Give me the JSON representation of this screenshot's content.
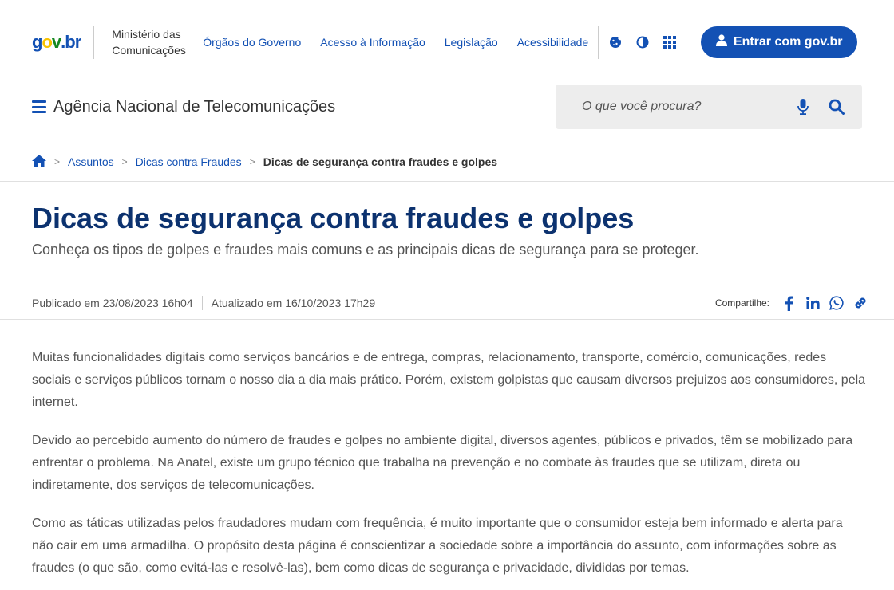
{
  "header": {
    "logo": {
      "g": "g",
      "o": "o",
      "v": "v",
      "dot": ".",
      "br": "br"
    },
    "ministry_line1": "Ministério das",
    "ministry_line2": "Comunicações",
    "links": [
      "Órgãos do Governo",
      "Acesso à Informação",
      "Legislação",
      "Acessibilidade"
    ],
    "tools": [
      "cookie-icon",
      "contrast-icon",
      "apps-grid-icon"
    ],
    "login_label": "Entrar com gov.br"
  },
  "nav": {
    "agency": "Agência Nacional de Telecomunicações",
    "search_placeholder": "O que você procura?"
  },
  "breadcrumb": {
    "items": [
      "Assuntos",
      "Dicas contra Fraudes"
    ],
    "current": "Dicas de segurança contra fraudes e golpes",
    "separator": ">"
  },
  "page": {
    "title": "Dicas de segurança contra fraudes e golpes",
    "subtitle": "Conheça os tipos de golpes e fraudes mais comuns e as principais dicas de segurança para se proteger.",
    "published": "Publicado em 23/08/2023 16h04",
    "updated": "Atualizado em 16/10/2023 17h29",
    "share_label": "Compartilhe:",
    "share_icons": [
      "facebook-icon",
      "linkedin-icon",
      "whatsapp-icon",
      "copy-link-icon"
    ],
    "paragraphs": [
      "Muitas funcionalidades digitais como serviços bancários e de entrega, compras, relacionamento, transporte, comércio, comunicações, redes sociais e serviços públicos tornam o nosso dia a dia mais prático. Porém, existem golpistas que causam diversos prejuizos aos consumidores, pela internet.",
      "Devido ao percebido aumento do número de fraudes e golpes no ambiente digital, diversos agentes, públicos e privados, têm se mobilizado para enfrentar o problema. Na Anatel, existe um grupo técnico que trabalha na prevenção e no combate às fraudes que se utilizam, direta ou indiretamente, dos serviços de telecomunicações.",
      "Como as táticas utilizadas pelos fraudadores mudam com frequência, é muito importante que o consumidor esteja bem informado e alerta para não cair em uma armadilha. O propósito desta página é conscientizar a sociedade sobre a importância do assunto, com informações sobre as fraudes (o que são, como evitá-las e resolvê-las), bem como dicas de segurança e privacidade, divididas por temas."
    ]
  },
  "colors": {
    "primary": "#1351b4",
    "title": "#0c326f",
    "logo_yellow": "#f8c300",
    "logo_green": "#168821"
  }
}
